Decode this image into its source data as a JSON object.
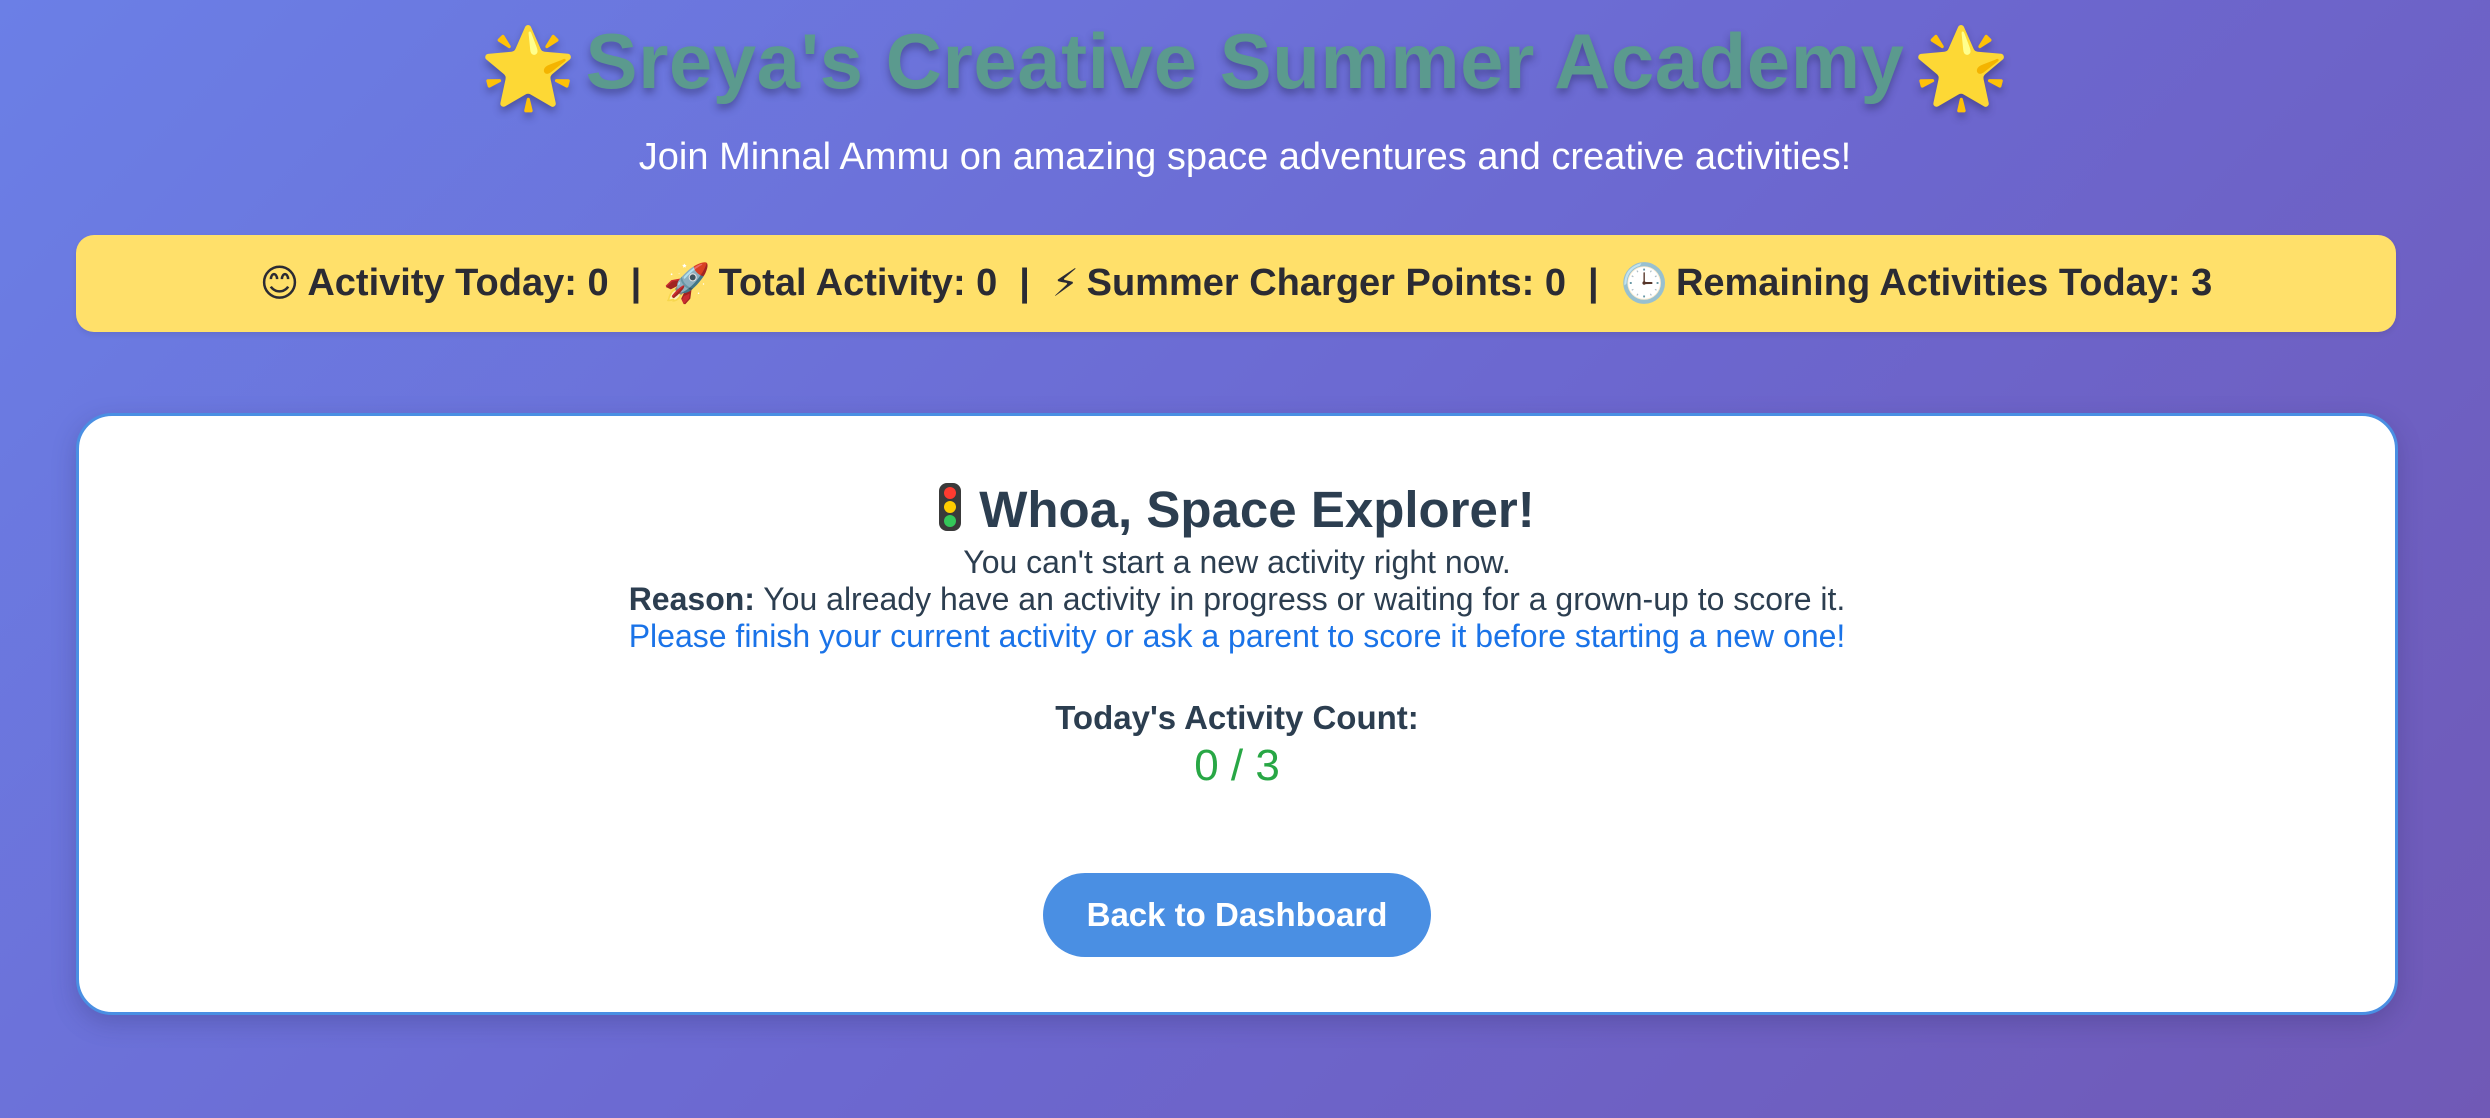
{
  "header": {
    "title": "Sreya's Creative Summer Academy",
    "title_icon_left": "🌟",
    "title_icon_right": "🌟",
    "subtitle": "Join Minnal Ammu on amazing space adventures and creative activities!"
  },
  "stats": {
    "activity_today": {
      "icon": "😊",
      "label": "Activity Today: 0"
    },
    "total_activity": {
      "icon": "🚀",
      "label": "Total Activity: 0"
    },
    "charger_points": {
      "icon": "⚡",
      "label": "Summer Charger Points: 0"
    },
    "remaining": {
      "icon": "🕒",
      "label": "Remaining Activities Today: 3"
    },
    "separator": "|"
  },
  "card": {
    "title": "Whoa, Space Explorer!",
    "message": "You can't start a new activity right now.",
    "reason_label": "Reason:",
    "reason_text": " You already have an activity in progress or waiting for a grown-up to score it.",
    "instruction": "Please finish your current activity or ask a parent to score it before starting a new one!",
    "count_label": "Today's Activity Count:",
    "count_value": "0 / 3",
    "back_button": "Back to Dashboard"
  },
  "colors": {
    "stats_bar": "#ffe06a",
    "accent_blue": "#4a8fe3",
    "count_green": "#28a745",
    "instruction_blue": "#1a73e8"
  }
}
